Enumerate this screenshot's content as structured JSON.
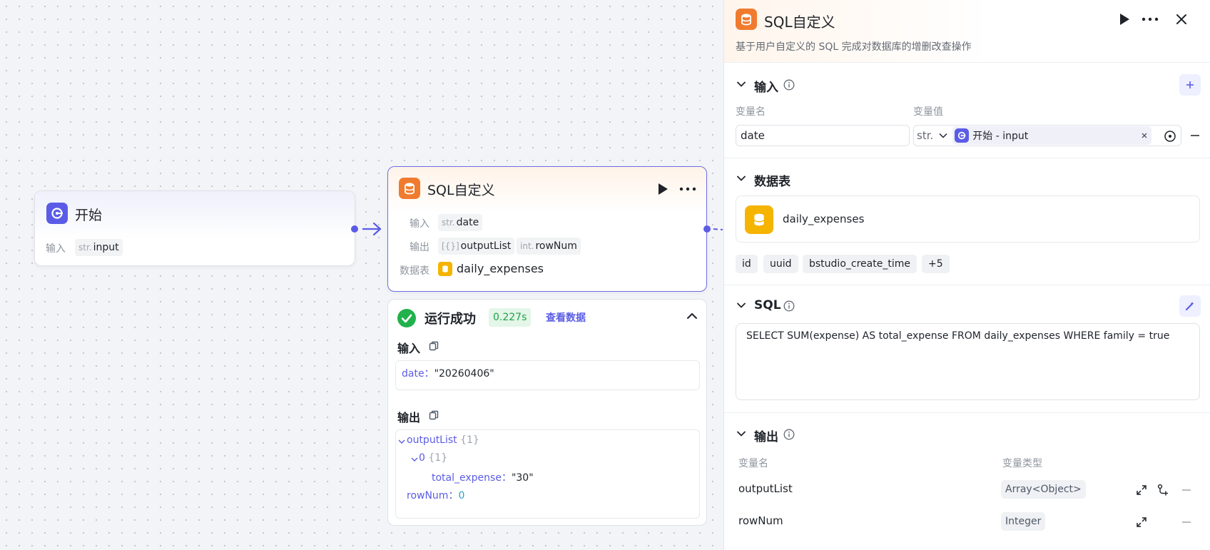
{
  "canvas": {
    "start_node": {
      "title": "开始",
      "input_label": "输入",
      "input_type": "str.",
      "input_name": "input"
    },
    "sql_node": {
      "title": "SQL自定义",
      "input_label": "输入",
      "input_type": "str.",
      "input_name": "date",
      "output_label": "输出",
      "output1_type": "[{}]",
      "output1_name": "outputList",
      "output2_type": "int.",
      "output2_name": "rowNum",
      "table_label": "数据表",
      "table_name": "daily_expenses"
    },
    "run_result": {
      "status": "运行成功",
      "duration": "0.227s",
      "view_data": "查看数据",
      "input_title": "输入",
      "input_key": "date",
      "input_value": "\"20260406\"",
      "output_title": "输出",
      "output_list_key": "outputList",
      "output_list_count": "{1}",
      "item_index": "0",
      "item_count": "{1}",
      "item_key": "total_expense",
      "item_value": "\"30\"",
      "rownum_key": "rowNum",
      "rownum_value": "0",
      "separator": "："
    }
  },
  "panel": {
    "title": "SQL自定义",
    "description": "基于用户自定义的 SQL 完成对数据库的增删改查操作",
    "input_section": {
      "title": "输入",
      "col_name": "变量名",
      "col_value": "变量值",
      "var_name": "date",
      "var_type": "str.",
      "ref_text": "开始 - input"
    },
    "table_section": {
      "title": "数据表",
      "table_name": "daily_expenses",
      "fields": [
        "id",
        "uuid",
        "bstudio_create_time",
        "+5"
      ]
    },
    "sql_section": {
      "title": "SQL",
      "query": "SELECT SUM(expense) AS total_expense FROM daily_expenses WHERE family = true"
    },
    "output_section": {
      "title": "输出",
      "col_name": "变量名",
      "col_type": "变量类型",
      "rows": [
        {
          "name": "outputList",
          "type": "Array<Object>"
        },
        {
          "name": "rowNum",
          "type": "Integer"
        }
      ]
    }
  },
  "colors": {
    "accent": "#5b5ce6",
    "sql_orange": "#f07b2f",
    "table_yellow": "#f5b400",
    "success_green": "#22b14c"
  }
}
